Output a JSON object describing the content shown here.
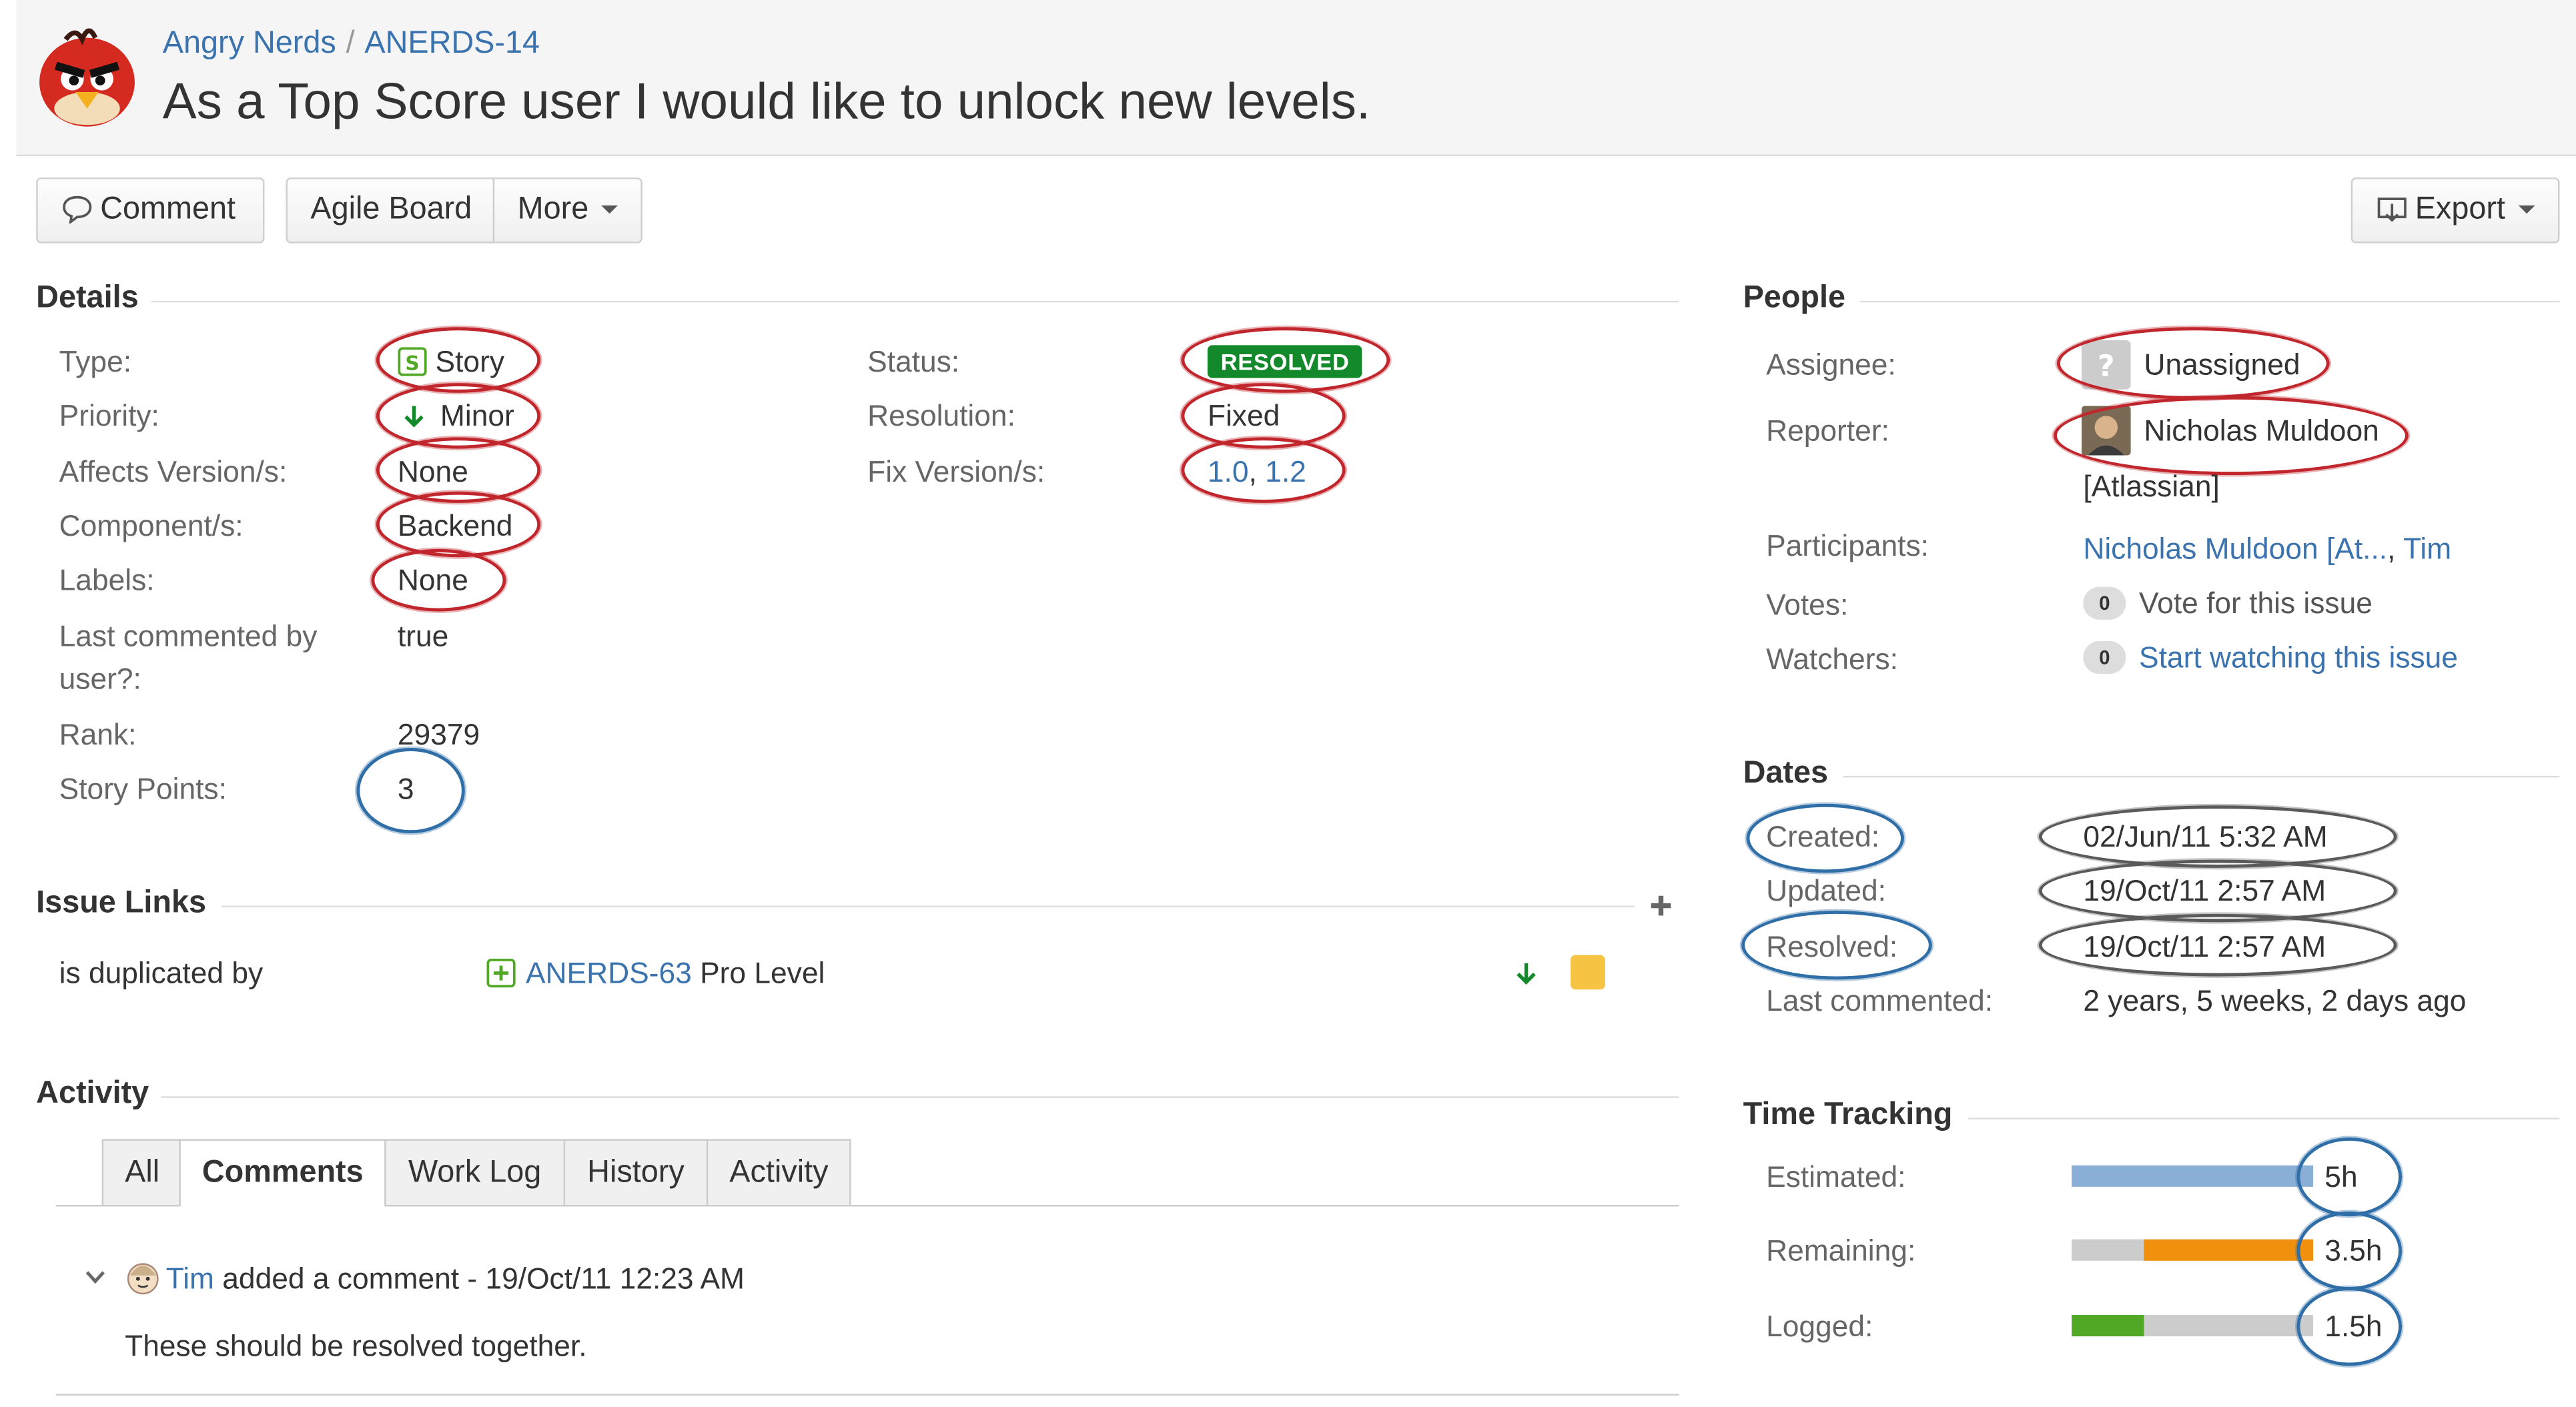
{
  "header": {
    "project": "Angry Nerds",
    "issue_key": "ANERDS-14",
    "summary": "As a Top Score user I would like to unlock new levels."
  },
  "toolbar": {
    "comment": "Comment",
    "agile_board": "Agile Board",
    "more": "More",
    "export": "Export"
  },
  "details": {
    "heading": "Details",
    "type_label": "Type:",
    "type_value": "Story",
    "priority_label": "Priority:",
    "priority_value": "Minor",
    "affects_label": "Affects Version/s:",
    "affects_value": "None",
    "component_label": "Component/s:",
    "component_value": "Backend",
    "labels_label": "Labels:",
    "labels_value": "None",
    "lastcommented_label_1": "Last commented by",
    "lastcommented_label_2": "user?:",
    "lastcommented_value": "true",
    "rank_label": "Rank:",
    "rank_value": "29379",
    "points_label": "Story Points:",
    "points_value": "3",
    "status_label": "Status:",
    "status_value": "RESOLVED",
    "resolution_label": "Resolution:",
    "resolution_value": "Fixed",
    "fix_label": "Fix Version/s:",
    "fix_value_1": "1.0",
    "fix_sep": ", ",
    "fix_value_2": "1.2"
  },
  "issue_links": {
    "heading": "Issue Links",
    "relation": "is duplicated by",
    "key": "ANERDS-63",
    "title": "Pro Level"
  },
  "activity": {
    "heading": "Activity",
    "tabs": [
      "All",
      "Comments",
      "Work Log",
      "History",
      "Activity"
    ],
    "active_tab": "Comments",
    "comment_author": "Tim",
    "comment_meta": "added a comment - 19/Oct/11 12:23 AM",
    "comment_body": "These should be resolved together."
  },
  "people": {
    "heading": "People",
    "assignee_label": "Assignee:",
    "assignee_value": "Unassigned",
    "reporter_label": "Reporter:",
    "reporter_value": "Nicholas Muldoon",
    "reporter_org": "[Atlassian]",
    "participants_label": "Participants:",
    "participant_1": "Nicholas Muldoon [At...",
    "participant_sep": ", ",
    "participant_2": "Tim",
    "votes_label": "Votes:",
    "votes_count": "0",
    "votes_link": "Vote for this issue",
    "watchers_label": "Watchers:",
    "watchers_count": "0",
    "watchers_link": "Start watching this issue"
  },
  "dates": {
    "heading": "Dates",
    "created_label": "Created:",
    "created_value": "02/Jun/11 5:32 AM",
    "updated_label": "Updated:",
    "updated_value": "19/Oct/11 2:57 AM",
    "resolved_label": "Resolved:",
    "resolved_value": "19/Oct/11 2:57 AM",
    "lastcommented_label": "Last commented:",
    "lastcommented_value": "2 years, 5 weeks, 2 days ago"
  },
  "time_tracking": {
    "heading": "Time Tracking",
    "estimated_label": "Estimated:",
    "estimated_value": "5h",
    "estimated_fraction": 1.0,
    "remaining_label": "Remaining:",
    "remaining_value": "3.5h",
    "remaining_fraction": 0.7,
    "logged_label": "Logged:",
    "logged_value": "1.5h",
    "logged_fraction": 0.3,
    "colors": {
      "estimated": "#89afd7",
      "remaining": "#f0900c",
      "logged": "#51a825",
      "empty": "#cccccc"
    }
  },
  "colors": {
    "link": "#3b73af",
    "resolved_lozenge": "#14892c",
    "annotation_red": "#c0262c",
    "annotation_blue": "#2f6ea6",
    "annotation_grey": "#5a5a5a"
  },
  "icons": [
    "angry-bird-avatar",
    "comment-icon",
    "export-icon",
    "story-icon",
    "minor-priority-icon",
    "add-link-icon",
    "new-feature-icon",
    "unassigned-avatar",
    "reporter-avatar",
    "tim-avatar",
    "collapse-icon"
  ]
}
